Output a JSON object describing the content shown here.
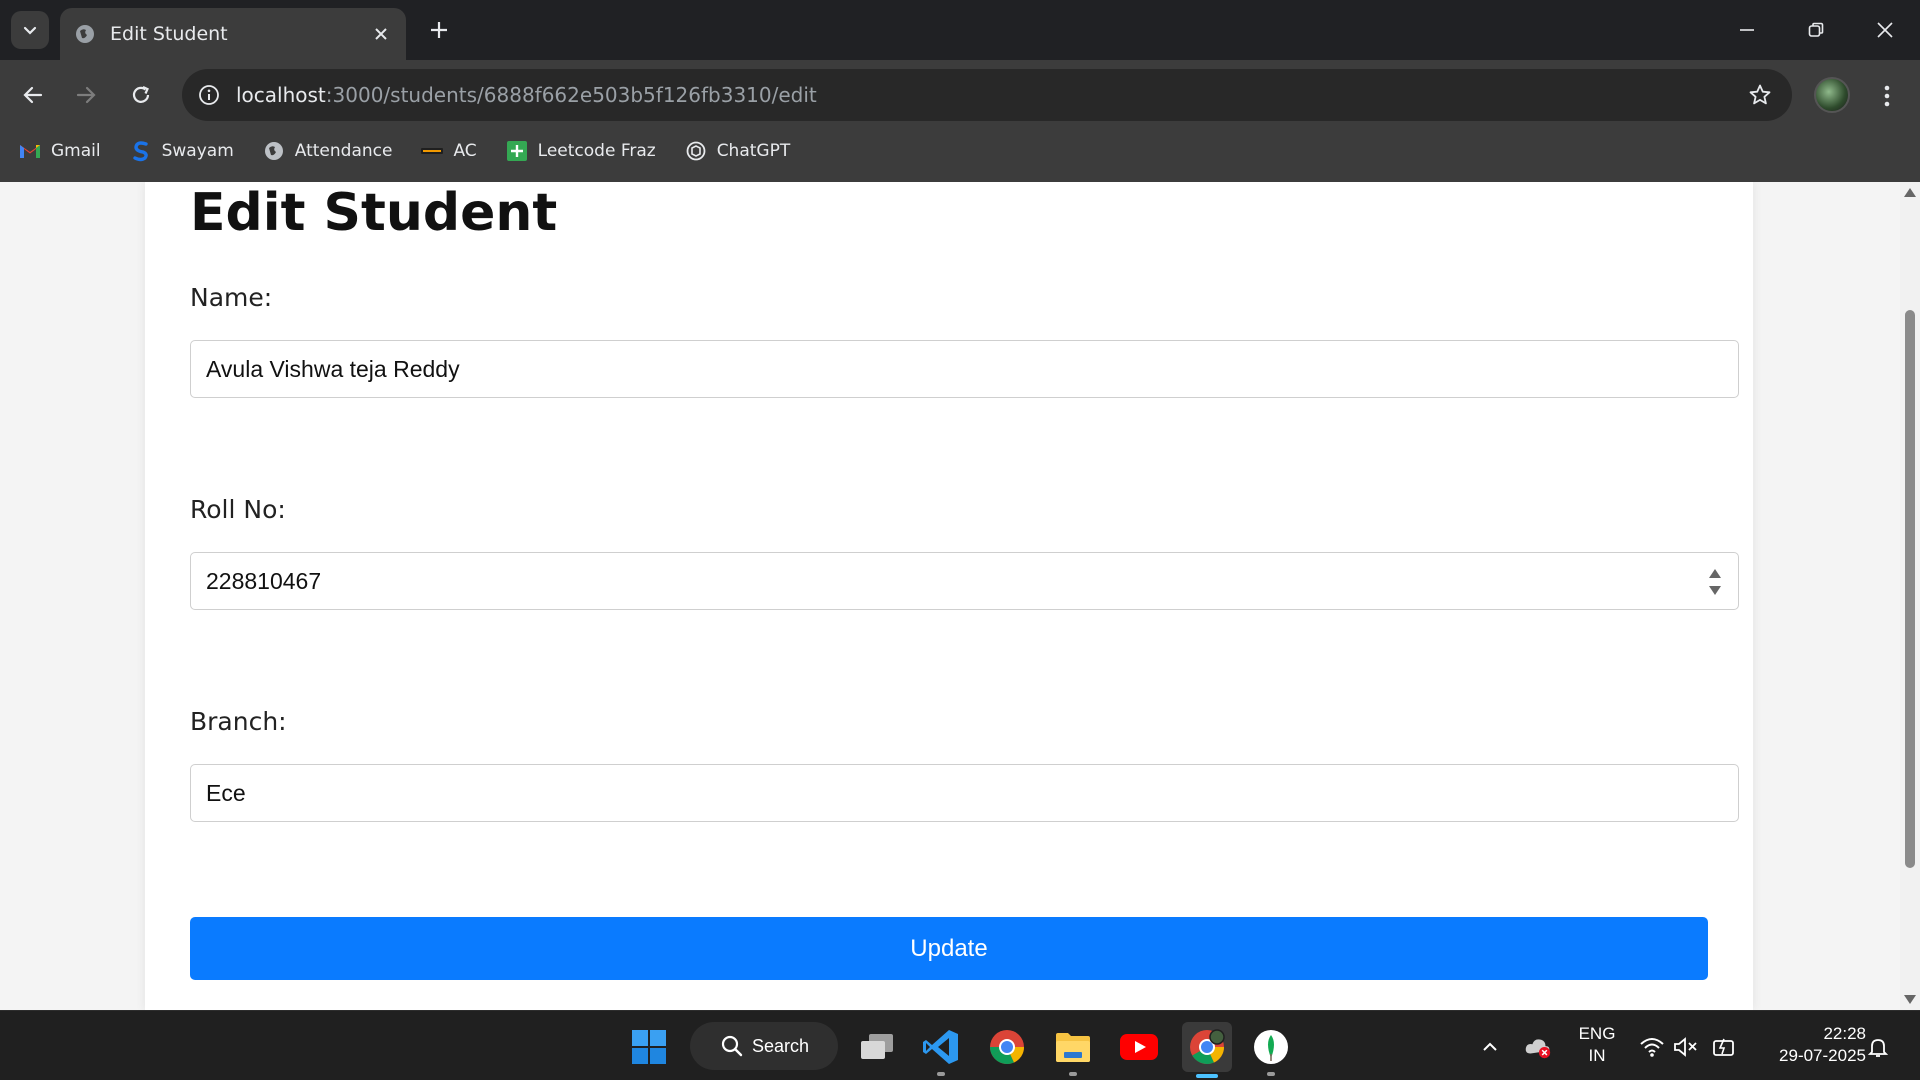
{
  "browser": {
    "tab_title": "Edit Student",
    "url_host": "localhost",
    "url_path": ":3000/students/6888f662e503b5f126fb3310/edit",
    "bookmarks": [
      {
        "label": "Gmail",
        "icon": "gmail-icon"
      },
      {
        "label": "Swayam",
        "icon": "swayam-icon"
      },
      {
        "label": "Attendance",
        "icon": "globe-icon"
      },
      {
        "label": "AC",
        "icon": "ac-icon"
      },
      {
        "label": "Leetcode Fraz",
        "icon": "sheets-icon"
      },
      {
        "label": "ChatGPT",
        "icon": "chatgpt-icon"
      }
    ]
  },
  "page": {
    "title": "Edit Student",
    "fields": {
      "name_label": "Name:",
      "name_value": "Avula Vishwa teja Reddy",
      "roll_label": "Roll No:",
      "roll_value": "228810467",
      "branch_label": "Branch:",
      "branch_value": "Ece"
    },
    "update_label": "Update"
  },
  "taskbar": {
    "search_label": "Search",
    "lang_top": "ENG",
    "lang_bottom": "IN",
    "time": "22:28",
    "date": "29-07-2025"
  },
  "colors": {
    "accent_button": "#0a7bff",
    "chrome_dark": "#202124",
    "chrome_toolbar": "#3c3c3c"
  }
}
